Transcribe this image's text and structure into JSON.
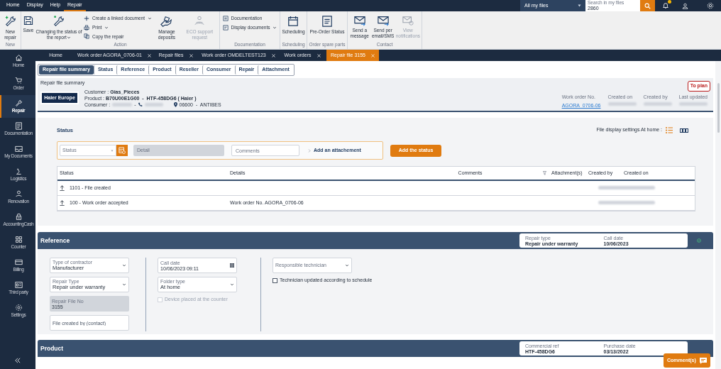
{
  "menu_bar": {
    "items": [
      {
        "label": "Home",
        "selected": false
      },
      {
        "label": "Display",
        "selected": false
      },
      {
        "label": "Help",
        "selected": false
      },
      {
        "label": "Repair",
        "selected": true
      }
    ],
    "scope_select": {
      "value": "All my files"
    },
    "search": {
      "label": "Search in my files",
      "value": "2860"
    }
  },
  "ribbon": {
    "groups": [
      {
        "label": "New",
        "buttons": [
          {
            "kind": "large",
            "label": "New repair",
            "dropdown": false,
            "disabled": false
          }
        ]
      },
      {
        "label": "Action",
        "buttons": [
          {
            "kind": "large",
            "label": "Save",
            "dropdown": false,
            "disabled": false
          },
          {
            "kind": "large",
            "label": "Changing the status of the report",
            "dropdown": true,
            "disabled": false
          },
          {
            "kind": "small",
            "label": "Create a linked document",
            "dropdown": true,
            "disabled": false
          },
          {
            "kind": "small",
            "label": "Print",
            "dropdown": true,
            "disabled": false
          },
          {
            "kind": "small",
            "label": "Copy the repair",
            "dropdown": false,
            "disabled": false
          },
          {
            "kind": "large",
            "label": "Manage deposits",
            "dropdown": false,
            "disabled": false
          },
          {
            "kind": "large",
            "label": "ECO support request",
            "dropdown": false,
            "disabled": true
          }
        ]
      },
      {
        "label": "Documentation",
        "buttons": [
          {
            "kind": "small",
            "label": "Documentation",
            "dropdown": false,
            "disabled": false
          },
          {
            "kind": "small",
            "label": "Display documents",
            "dropdown": true,
            "disabled": false
          }
        ]
      },
      {
        "label": "Scheduling",
        "buttons": [
          {
            "kind": "large",
            "label": "Scheduling",
            "dropdown": false,
            "disabled": false
          }
        ]
      },
      {
        "label": "Order spare parts",
        "buttons": [
          {
            "kind": "large",
            "label": "Pre-Order Status",
            "dropdown": false,
            "disabled": false
          }
        ]
      },
      {
        "label": "Contact",
        "buttons": [
          {
            "kind": "large",
            "label": "Send a message",
            "dropdown": false,
            "disabled": false
          },
          {
            "kind": "large",
            "label": "Send per email/SMS",
            "dropdown": false,
            "disabled": false
          },
          {
            "kind": "large",
            "label": "View notifications",
            "dropdown": false,
            "disabled": true
          }
        ]
      }
    ]
  },
  "tabs": [
    {
      "label": "Home",
      "selected": false,
      "closable": false
    },
    {
      "label": "Work order AGORA_0706-01",
      "selected": false,
      "closable": true
    },
    {
      "label": "Repair files",
      "selected": false,
      "closable": true
    },
    {
      "label": "Work order OMDELTEST123",
      "selected": false,
      "closable": true
    },
    {
      "label": "Work orders",
      "selected": false,
      "closable": true
    },
    {
      "label": "Repair file 3155",
      "selected": true,
      "closable": true
    }
  ],
  "sidebar": {
    "items": [
      {
        "label": "Home",
        "selected": false
      },
      {
        "label": "Order",
        "selected": false
      },
      {
        "label": "Repair",
        "selected": true
      },
      {
        "label": "Documentation",
        "selected": false
      },
      {
        "label": "My Documents",
        "selected": false
      },
      {
        "label": "Logistics",
        "selected": false
      },
      {
        "label": "Renovation",
        "selected": false
      },
      {
        "label": "AccountingCash",
        "selected": false
      },
      {
        "label": "Counter",
        "selected": false
      },
      {
        "label": "Billing",
        "selected": false
      },
      {
        "label": "Third party",
        "selected": false
      },
      {
        "label": "Settings",
        "selected": false
      }
    ]
  },
  "section_tabs": [
    {
      "label": "Repair file summary",
      "selected": true
    },
    {
      "label": "Status",
      "selected": false
    },
    {
      "label": "Reference",
      "selected": false
    },
    {
      "label": "Product",
      "selected": false
    },
    {
      "label": "Reseller",
      "selected": false
    },
    {
      "label": "Consumer",
      "selected": false
    },
    {
      "label": "Repair",
      "selected": false
    },
    {
      "label": "Attachment",
      "selected": false
    }
  ],
  "summary": {
    "title": "Repair file summary",
    "logo": "Haier Europe",
    "customer": "Customer : **Gias_Pieces**",
    "product": "Product : **B70U00E1G00  -  HTF-458DG6 ( Haier )**",
    "consumer": {
      "label": "Consumer :",
      "separator": "-"
    },
    "location": "06600  -  ANTIBES",
    "badge": "To plan",
    "meta": [
      {
        "label": "Work order No.",
        "kind": "link",
        "value": "AGORA_0706-06"
      },
      {
        "label": "Created on",
        "kind": "blurred"
      },
      {
        "label": "Created by",
        "kind": "blurred"
      },
      {
        "label": "Last updated",
        "kind": "blurred"
      }
    ]
  },
  "status_section": {
    "title": "Status",
    "display_settings_label": "File display settings At home :",
    "form": {
      "status_placeholder": "Status",
      "detail_placeholder": "Detail",
      "comments_placeholder": "Comments",
      "attachment_link": "Add an attachement"
    },
    "add_button": "Add the status",
    "table": {
      "columns": [
        "Status",
        "Details",
        "Comments",
        "Attachment(s)",
        "Created by",
        "Created on"
      ],
      "rows": [
        {
          "status": "1101 - File created"
        },
        {
          "status": "100 - Work order accepted",
          "details": "Work order No. AGORA_0706-06"
        }
      ]
    }
  },
  "reference": {
    "title": "Reference",
    "summary": [
      {
        "label": "Repair type",
        "value": "Repair under warranty"
      },
      {
        "label": "Call date",
        "value": "10/06/2023"
      }
    ],
    "columns": [
      [
        {
          "kind": "select",
          "label": "Type of contractor",
          "value": "Manufacturer"
        },
        {
          "kind": "select",
          "label": "Repair Type",
          "value": "Repair under warranty"
        },
        {
          "kind": "readonly",
          "label": "Repair File No",
          "value": "3155"
        },
        {
          "kind": "text",
          "placeholder": "File created by (contact)"
        }
      ],
      [
        {
          "kind": "date",
          "label": "Call date",
          "value": "10/06/2023 09:11"
        },
        {
          "kind": "select",
          "label": "Folder type",
          "value": "At home"
        },
        {
          "kind": "checkbox",
          "label": "Device placed at the counter",
          "checked": false,
          "disabled": true
        }
      ],
      [
        {
          "kind": "select",
          "placeholder": "Responsible technician"
        },
        {
          "kind": "checkbox",
          "label": "Technician updated according to schedule",
          "checked": false,
          "disabled": false
        }
      ]
    ]
  },
  "product": {
    "title": "Product",
    "summary": [
      {
        "label": "Commercial ref",
        "value": "HTF-458DG6"
      },
      {
        "label": "Purchase date",
        "value": "03/13/2022"
      }
    ]
  },
  "comments_button": "Comment(s)"
}
